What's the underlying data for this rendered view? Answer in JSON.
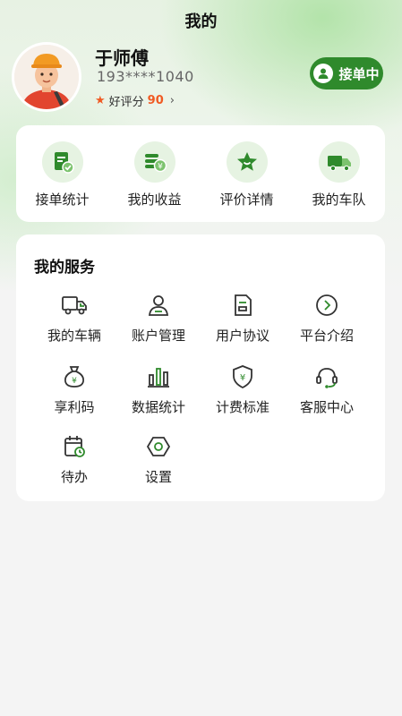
{
  "header": {
    "title": "我的"
  },
  "profile": {
    "name": "于师傅",
    "phone": "193****1040",
    "rating_label": "好评分",
    "rating_value": "90",
    "status_label": "接单中"
  },
  "stats": [
    {
      "label": "接单统计",
      "icon": "order-stats-icon"
    },
    {
      "label": "我的收益",
      "icon": "earnings-icon"
    },
    {
      "label": "评价详情",
      "icon": "star-review-icon"
    },
    {
      "label": "我的车队",
      "icon": "fleet-truck-icon"
    }
  ],
  "services": {
    "title": "我的服务",
    "items": [
      {
        "label": "我的车辆",
        "icon": "truck-icon"
      },
      {
        "label": "账户管理",
        "icon": "user-account-icon"
      },
      {
        "label": "用户协议",
        "icon": "document-icon"
      },
      {
        "label": "平台介绍",
        "icon": "arrow-circle-icon"
      },
      {
        "label": "享利码",
        "icon": "money-bag-icon"
      },
      {
        "label": "数据统计",
        "icon": "bar-chart-icon"
      },
      {
        "label": "计费标准",
        "icon": "shield-yen-icon"
      },
      {
        "label": "客服中心",
        "icon": "headset-icon"
      },
      {
        "label": "待办",
        "icon": "calendar-clock-icon"
      },
      {
        "label": "设置",
        "icon": "settings-hexagon-icon"
      }
    ]
  },
  "colors": {
    "accent": "#2f8a2c",
    "icon_bg": "#e6f3e2",
    "rating": "#f05a23"
  }
}
